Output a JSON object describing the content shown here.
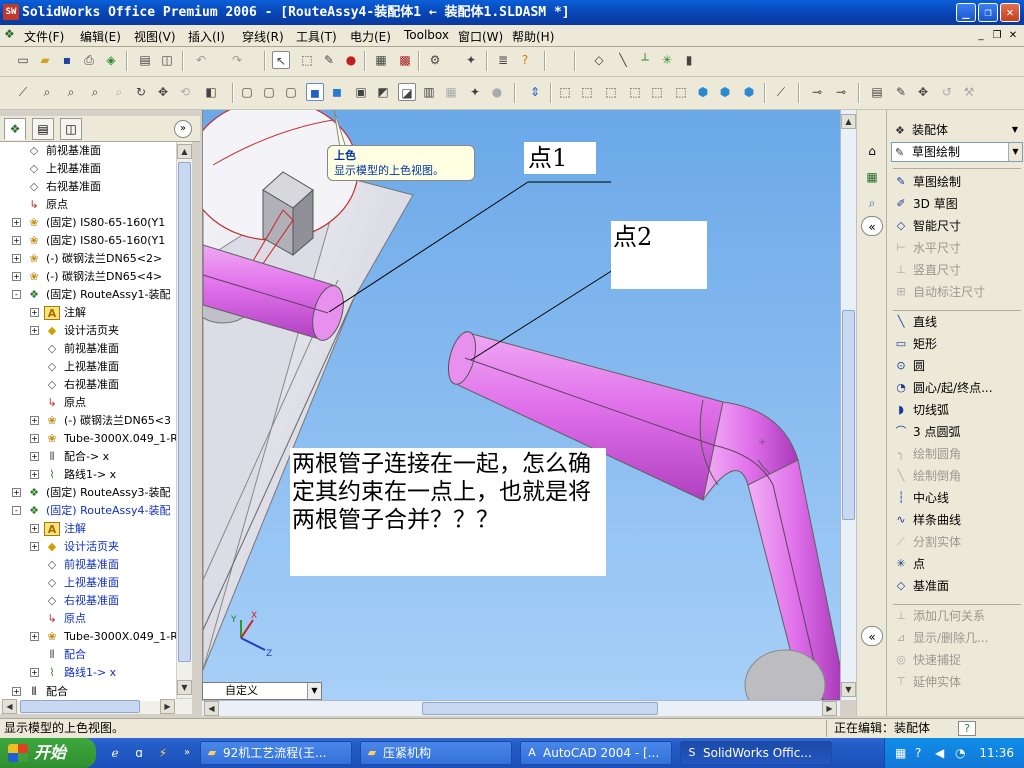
{
  "window": {
    "title": "SolidWorks Office Premium 2006 - [RouteAssy4-装配体1 ← 装配体1.SLDASM *]",
    "app_icon": "SW"
  },
  "menu": [
    "文件(F)",
    "编辑(E)",
    "视图(V)",
    "插入(I)",
    "穿线(R)",
    "工具(T)",
    "电力(E)",
    "Toolbox",
    "窗口(W)",
    "帮助(H)"
  ],
  "tree": {
    "rows": [
      {
        "indent": 1,
        "icon": "plane-icon",
        "label": "前视基准面",
        "blue": false,
        "exp": ""
      },
      {
        "indent": 1,
        "icon": "plane-icon",
        "label": "上视基准面",
        "blue": false,
        "exp": ""
      },
      {
        "indent": 1,
        "icon": "plane-icon",
        "label": "右视基准面",
        "blue": false,
        "exp": ""
      },
      {
        "indent": 1,
        "icon": "origin-icon",
        "label": "原点",
        "blue": false,
        "exp": ""
      },
      {
        "indent": 1,
        "icon": "part-icon",
        "label": "(固定) IS80-65-160(Y1",
        "blue": false,
        "exp": "+"
      },
      {
        "indent": 1,
        "icon": "part-icon",
        "label": "(固定) IS80-65-160(Y1",
        "blue": false,
        "exp": "+"
      },
      {
        "indent": 1,
        "icon": "part-icon",
        "label": "(-) 碳钢法兰DN65<2>",
        "blue": false,
        "exp": "+"
      },
      {
        "indent": 1,
        "icon": "part-icon",
        "label": "(-) 碳钢法兰DN65<4>",
        "blue": false,
        "exp": "+"
      },
      {
        "indent": 1,
        "icon": "assembly-icon",
        "label": "(固定) RouteAssy1-装配",
        "blue": false,
        "exp": "-"
      },
      {
        "indent": 2,
        "icon": "annotation-icon",
        "label": "注解",
        "blue": false,
        "exp": "+"
      },
      {
        "indent": 2,
        "icon": "design-binder-icon",
        "label": "设计活页夹",
        "blue": false,
        "exp": "+"
      },
      {
        "indent": 2,
        "icon": "plane-icon",
        "label": "前视基准面",
        "blue": false,
        "exp": ""
      },
      {
        "indent": 2,
        "icon": "plane-icon",
        "label": "上视基准面",
        "blue": false,
        "exp": ""
      },
      {
        "indent": 2,
        "icon": "plane-icon",
        "label": "右视基准面",
        "blue": false,
        "exp": ""
      },
      {
        "indent": 2,
        "icon": "origin-icon",
        "label": "原点",
        "blue": false,
        "exp": ""
      },
      {
        "indent": 2,
        "icon": "part-icon",
        "label": "(-) 碳钢法兰DN65<3",
        "blue": false,
        "exp": "+"
      },
      {
        "indent": 2,
        "icon": "part-icon",
        "label": "Tube-3000X.049_1-R",
        "blue": false,
        "exp": "+"
      },
      {
        "indent": 2,
        "icon": "mate-icon",
        "label": "配合-> x",
        "blue": false,
        "exp": "+"
      },
      {
        "indent": 2,
        "icon": "route-icon",
        "label": "路线1-> x",
        "blue": false,
        "exp": "+"
      },
      {
        "indent": 1,
        "icon": "assembly-icon",
        "label": "(固定) RouteAssy3-装配",
        "blue": false,
        "exp": "+"
      },
      {
        "indent": 1,
        "icon": "assembly-icon",
        "label": "(固定) RouteAssy4-装配",
        "blue": true,
        "exp": "-"
      },
      {
        "indent": 2,
        "icon": "annotation-icon",
        "label": "注解",
        "blue": true,
        "exp": "+"
      },
      {
        "indent": 2,
        "icon": "design-binder-icon",
        "label": "设计活页夹",
        "blue": true,
        "exp": "+"
      },
      {
        "indent": 2,
        "icon": "plane-icon",
        "label": "前视基准面",
        "blue": true,
        "exp": ""
      },
      {
        "indent": 2,
        "icon": "plane-icon",
        "label": "上视基准面",
        "blue": true,
        "exp": ""
      },
      {
        "indent": 2,
        "icon": "plane-icon",
        "label": "右视基准面",
        "blue": true,
        "exp": ""
      },
      {
        "indent": 2,
        "icon": "origin-icon",
        "label": "原点",
        "blue": true,
        "exp": ""
      },
      {
        "indent": 2,
        "icon": "part-icon",
        "label": "Tube-3000X.049_1-R",
        "blue": false,
        "exp": "+"
      },
      {
        "indent": 2,
        "icon": "mate-icon",
        "label": "配合",
        "blue": true,
        "exp": ""
      },
      {
        "indent": 2,
        "icon": "route-icon",
        "label": "路线1-> x",
        "blue": true,
        "exp": "+"
      }
    ],
    "bottom_row": {
      "label": "配合",
      "icon": "mate-icon"
    }
  },
  "viewport": {
    "tooltip_title": "上色",
    "tooltip_text": "显示模型的上色视图。",
    "point1": "点1",
    "point2": "点2",
    "question": "两根管子连接在一起，怎么确定其约束在一点上，也就是将两根管子合并？？？",
    "zoom_combo": "自定义"
  },
  "right_panel": {
    "combo1": "装配体",
    "combo2": "草图绘制",
    "group1": [
      {
        "label": "草图绘制",
        "icon": "sketch-icon",
        "disabled": false
      },
      {
        "label": "3D 草图",
        "icon": "3d-sketch-icon",
        "disabled": false
      },
      {
        "label": "智能尺寸",
        "icon": "smart-dimension-icon",
        "disabled": false
      },
      {
        "label": "水平尺寸",
        "icon": "horizontal-dimension-icon",
        "disabled": true
      },
      {
        "label": "竖直尺寸",
        "icon": "vertical-dimension-icon",
        "disabled": true
      },
      {
        "label": "自动标注尺寸",
        "icon": "auto-dimension-icon",
        "disabled": true
      }
    ],
    "group2": [
      {
        "label": "直线",
        "icon": "line-icon",
        "disabled": false
      },
      {
        "label": "矩形",
        "icon": "rectangle-icon",
        "disabled": false
      },
      {
        "label": "圆",
        "icon": "circle-icon",
        "disabled": false
      },
      {
        "label": "圆心/起/终点...",
        "icon": "center-arc-icon",
        "disabled": false
      },
      {
        "label": "切线弧",
        "icon": "tangent-arc-icon",
        "disabled": false
      },
      {
        "label": "3 点圆弧",
        "icon": "3point-arc-icon",
        "disabled": false
      },
      {
        "label": "绘制圆角",
        "icon": "fillet-icon",
        "disabled": true
      },
      {
        "label": "绘制倒角",
        "icon": "chamfer-icon",
        "disabled": true
      },
      {
        "label": "中心线",
        "icon": "centerline-icon",
        "disabled": false
      },
      {
        "label": "样条曲线",
        "icon": "spline-icon",
        "disabled": false
      },
      {
        "label": "分割实体",
        "icon": "split-icon",
        "disabled": true
      },
      {
        "label": "点",
        "icon": "point-icon",
        "disabled": false
      },
      {
        "label": "基准面",
        "icon": "plane-icon",
        "disabled": false
      }
    ],
    "group3": [
      {
        "label": "添加几何关系",
        "icon": "add-relation-icon",
        "disabled": true
      },
      {
        "label": "显示/删除几...",
        "icon": "display-relation-icon",
        "disabled": true
      },
      {
        "label": "快速捕捉",
        "icon": "quick-snap-icon",
        "disabled": true
      },
      {
        "label": "延伸实体",
        "icon": "extend-icon",
        "disabled": true
      }
    ]
  },
  "status": {
    "left": "显示模型的上色视图。",
    "right": "正在编辑：装配体",
    "help": "?"
  },
  "taskbar": {
    "start": "开始",
    "tasks": [
      {
        "label": "92机工艺流程(王...",
        "icon": "folder-icon",
        "active": false
      },
      {
        "label": "压紧机构",
        "icon": "folder-icon",
        "active": false
      },
      {
        "label": "AutoCAD 2004 - [...",
        "icon": "autocad-icon",
        "active": false
      },
      {
        "label": "SolidWorks Offic...",
        "icon": "solidworks-icon",
        "active": true
      }
    ],
    "time": "11:36"
  }
}
